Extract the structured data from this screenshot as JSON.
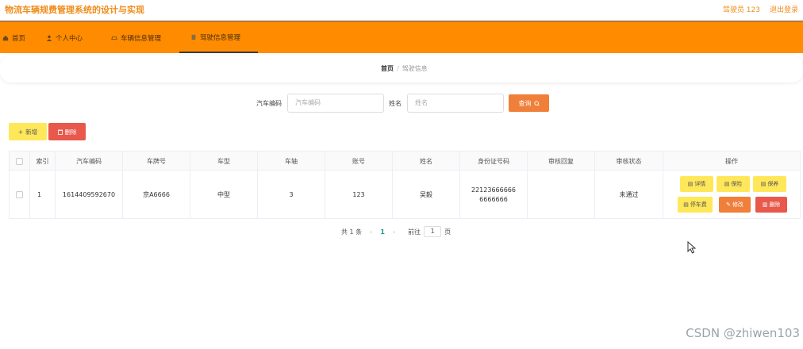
{
  "header": {
    "app_title": "物流车辆规费管理系统的设计与实现",
    "user_label": "驾驶员 123",
    "logout_label": "退出登录"
  },
  "nav": {
    "items": [
      {
        "label": "首页",
        "icon": "home-icon"
      },
      {
        "label": "个人中心",
        "icon": "user-icon"
      },
      {
        "label": "车辆信息管理",
        "icon": "car-icon"
      },
      {
        "label": "驾驶信息管理",
        "icon": "document-icon"
      }
    ],
    "active_index": 3
  },
  "breadcrumb": {
    "home": "首页",
    "separator": "/",
    "current": "驾驶信息"
  },
  "search": {
    "car_code_label": "汽车编码",
    "car_code_placeholder": "汽车编码",
    "name_label": "姓名",
    "name_placeholder": "姓名",
    "query_label": "查询"
  },
  "actions": {
    "add_label": "新增",
    "delete_label": "删除"
  },
  "table": {
    "columns": [
      "索引",
      "汽车编码",
      "车牌号",
      "车型",
      "车轴",
      "账号",
      "姓名",
      "身份证号码",
      "审核回复",
      "审核状态",
      "操作"
    ],
    "rows": [
      {
        "index": "1",
        "car_code": "1614409592670",
        "plate": "京A6666",
        "model": "中型",
        "axle": "3",
        "account": "123",
        "name": "吴毅",
        "id_number": "221236666666666666",
        "review_reply": "",
        "review_status": "未通过"
      }
    ],
    "row_buttons": [
      "详情",
      "保险",
      "保养",
      "停车费",
      "修改",
      "删除"
    ]
  },
  "pagination": {
    "total_text": "共 1 条",
    "current_page": "1",
    "goto_label": "前往",
    "goto_value": "1",
    "page_suffix": "页"
  },
  "watermark": "CSDN @zhiwen103",
  "colors": {
    "accent": "#ff8c00",
    "yellow_button": "#ffe75a",
    "orange_button": "#f07f3a",
    "red_button": "#e8584b"
  }
}
